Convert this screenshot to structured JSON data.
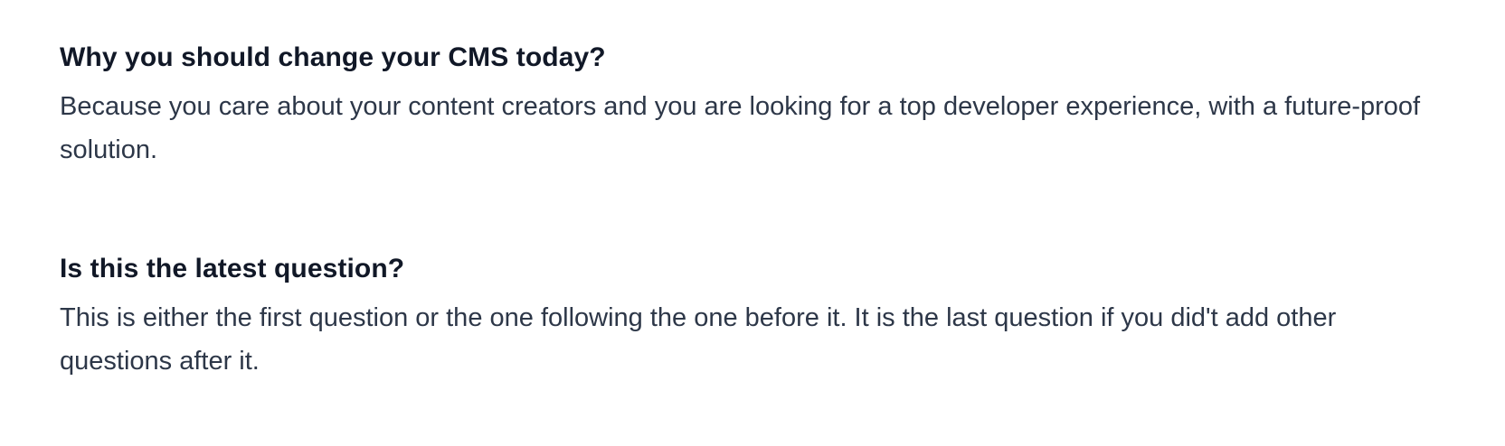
{
  "faq": {
    "items": [
      {
        "question": "Why you should change your CMS today?",
        "answer": "Because you care about your content creators and you are looking for a top developer experience, with a future-proof solution."
      },
      {
        "question": "Is this the latest question?",
        "answer": "This is either the first question or the one following the one before it. It is the last question if you did't add other questions after it."
      }
    ]
  }
}
